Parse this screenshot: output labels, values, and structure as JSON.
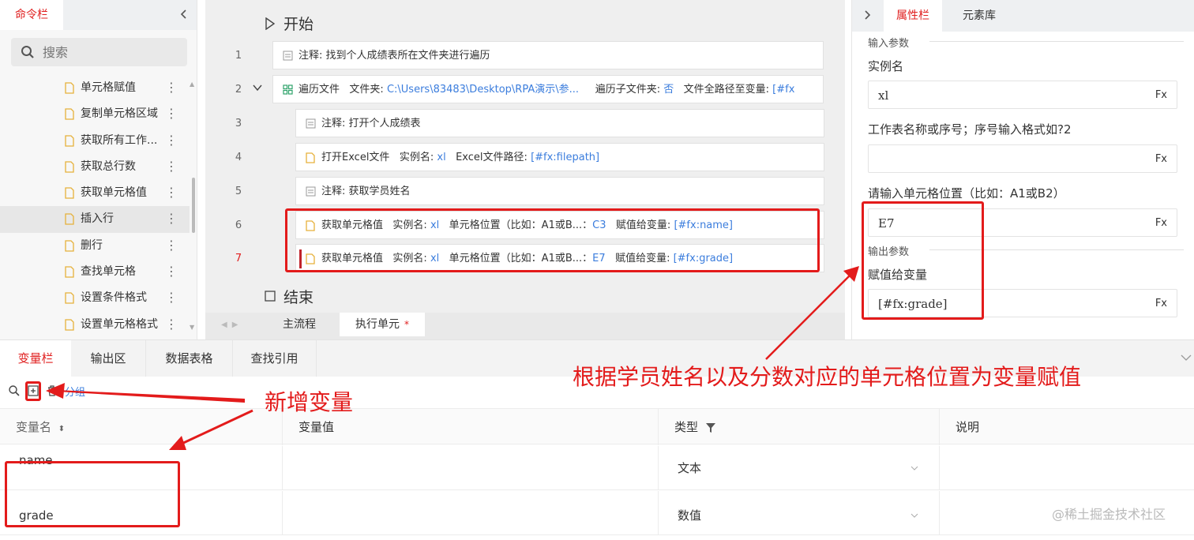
{
  "left_panel": {
    "tab": "命令栏",
    "search_placeholder": "搜索",
    "items": [
      {
        "label": "单元格赋值"
      },
      {
        "label": "复制单元格区域"
      },
      {
        "label": "获取所有工作..."
      },
      {
        "label": "获取总行数"
      },
      {
        "label": "获取单元格值"
      },
      {
        "label": "插入行",
        "selected": true
      },
      {
        "label": "删行"
      },
      {
        "label": "查找单元格"
      },
      {
        "label": "设置条件格式"
      },
      {
        "label": "设置单元格格式"
      }
    ]
  },
  "flow": {
    "start_label": "开始",
    "end_label": "结束",
    "steps": [
      {
        "num": "1",
        "name": "注释:",
        "text": "找到个人成绩表所在文件夹进行遍历"
      },
      {
        "num": "2",
        "name": "遍历文件",
        "p1_label": "文件夹:",
        "p1_value": "C:\\Users\\83483\\Desktop\\RPA演示\\参...",
        "p2_label": "遍历子文件夹:",
        "p2_value": "否",
        "p3_label": "文件全路径至变量:",
        "p3_value": "[#fx"
      },
      {
        "num": "3",
        "name": "注释:",
        "text": "打开个人成绩表"
      },
      {
        "num": "4",
        "name": "打开Excel文件",
        "p1_label": "实例名:",
        "p1_value": "xl",
        "p2_label": "Excel文件路径:",
        "p2_value": "[#fx:filepath]"
      },
      {
        "num": "5",
        "name": "注释:",
        "text": "获取学员姓名"
      },
      {
        "num": "6",
        "name": "获取单元格值",
        "p1_label": "实例名:",
        "p1_value": "xl",
        "p2_label": "单元格位置（比如：A1或B...：",
        "p2_value": "C3",
        "p3_label": "赋值给变量:",
        "p3_value": "[#fx:name]"
      },
      {
        "num": "7",
        "name": "获取单元格值",
        "p1_label": "实例名:",
        "p1_value": "xl",
        "p2_label": "单元格位置（比如：A1或B...：",
        "p2_value": "E7",
        "p3_label": "赋值给变量:",
        "p3_value": "[#fx:grade]"
      }
    ],
    "bottom_tabs": [
      {
        "label": "主流程"
      },
      {
        "label": "执行单元",
        "modified": "*"
      }
    ]
  },
  "props": {
    "tabs": [
      {
        "label": "属性栏"
      },
      {
        "label": "元素库"
      }
    ],
    "input_section": "输入参数",
    "output_section": "输出参数",
    "fx_label": "Fx",
    "fields": [
      {
        "label": "实例名",
        "value": "xl"
      },
      {
        "label": "工作表名称或序号；序号输入格式如?2",
        "value": ""
      },
      {
        "label": "请输入单元格位置（比如：A1或B2）",
        "value": "E7"
      }
    ],
    "output_field": {
      "label": "赋值给变量",
      "value": "[#fx:grade]"
    }
  },
  "bottom": {
    "tabs": [
      {
        "label": "变量栏"
      },
      {
        "label": "输出区"
      },
      {
        "label": "数据表格"
      },
      {
        "label": "查找引用"
      }
    ],
    "group_label": "分组",
    "columns": [
      {
        "label": "变量名"
      },
      {
        "label": "变量值"
      },
      {
        "label": "类型"
      },
      {
        "label": "说明"
      }
    ],
    "rows": [
      {
        "name": "name",
        "value": "",
        "type": "文本",
        "desc": ""
      },
      {
        "name": "grade",
        "value": "",
        "type": "数值",
        "desc": ""
      }
    ]
  },
  "annotations": {
    "main": "根据学员姓名以及分数对应的单元格位置为变量赋值",
    "add_var": "新增变量",
    "color": "#e31b1b"
  },
  "watermark": "@稀土掘金技术社区"
}
